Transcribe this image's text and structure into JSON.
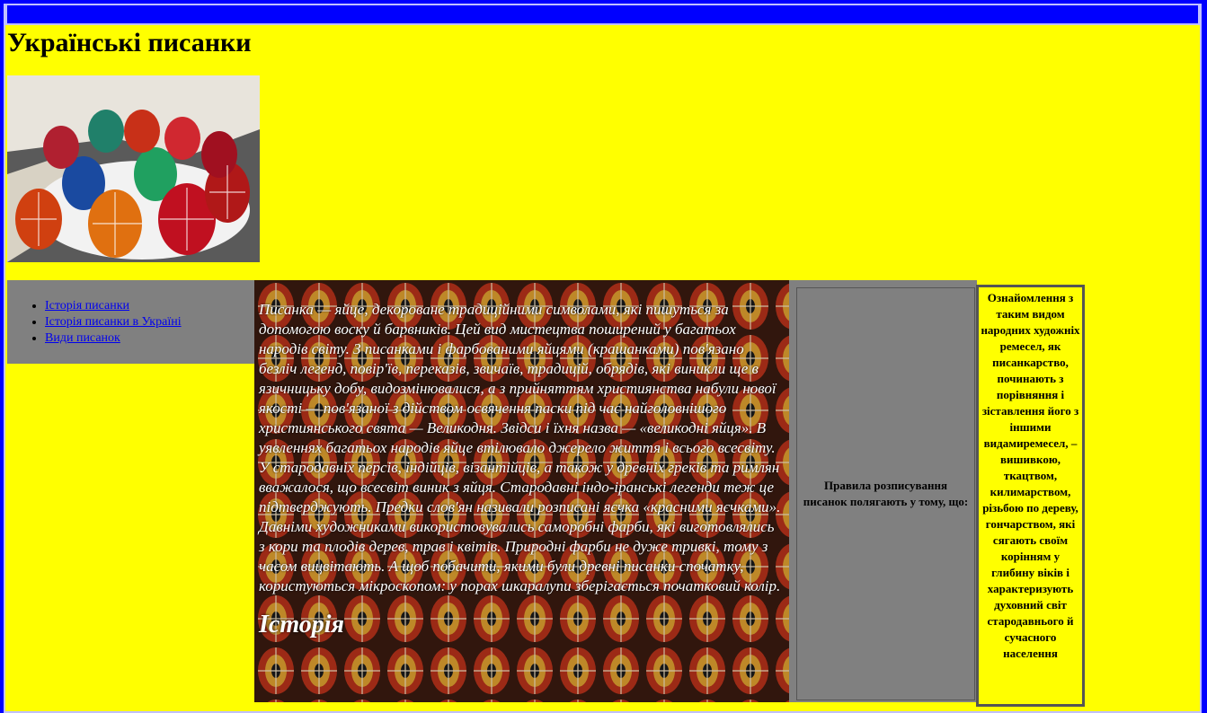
{
  "site": {
    "title": "Українські писанки"
  },
  "nav": {
    "items": [
      {
        "label": "Історія писанки"
      },
      {
        "label": "Історія писанки в Україні"
      },
      {
        "label": "Види писанок"
      }
    ]
  },
  "article": {
    "body": "Писанка — яйце, декороване традиційними символами, які пишуться за допомогою воску й барвників. Цей вид мистецтва поширений у багатьох народів світу. З писанками і фарбованими яйцями (крашанками) пов'язано безліч легенд, повір'їв, переказів, звичаїв, традицій, обрядів, які виникли ще в язичницьку добу, видозмінювалися, а з прийняттям християнства набули нової якості — пов'язаної з дійством освячення паски під час найголовнішого християнського свята — Великодня. Звідси і їхня назва — «великодні яйця». В уявленнях багатьох народів яйце втілювало джерело життя і всього всесвіту. У стародавніх персів, індійців, візантійців, а також у древніх греків та римлян вважалося, що всесвіт виник з яйця. Стародавні індо-іранські легенди теж це підтверджують. Предки слов'ян називали розписані яєчка «красними яєчками». Давніми художниками використовувались саморобні фарби, які виготовлялись з кори та плодів дерев, трав і квітів. Природні фарби не дуже тривкі, тому з часом вицвітають. А щоб побачити, якими були древні писанки спочатку, користуються мікроскопом: у порах шкаралупи зберігається початковий колір.",
    "heading": "Історія"
  },
  "rules": {
    "text": "Правила розписування писанок полягають у тому, що:"
  },
  "intro": {
    "text": "Ознайомлення з таким видом народних художніх ремесел, як писанкарство, починають з порівняння і зіставлення його з іншими видамиремесел, – вишивкою, ткацтвом, килимарством, різьбою по дереву, гончарством, які сягають своїм корінням у глибину віків і характеризують духовний світ стародавнього й сучасного населення"
  },
  "colors": {
    "page_bg": "#ffff00",
    "frame": "#0000ff",
    "nav_bg": "#808080",
    "link": "#0000ee"
  },
  "icons": {
    "hero_image": "pysanky-eggs-photo",
    "article_background": "pysanky-pattern"
  }
}
